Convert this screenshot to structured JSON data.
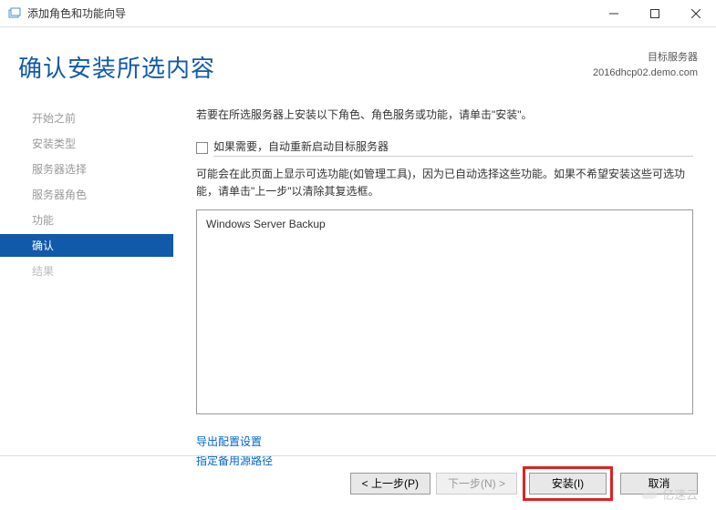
{
  "window": {
    "title": "添加角色和功能向导"
  },
  "header": {
    "page_title": "确认安装所选内容",
    "server_label": "目标服务器",
    "server_name": "2016dhcp02.demo.com"
  },
  "sidebar": {
    "items": [
      {
        "label": "开始之前",
        "state": "completed"
      },
      {
        "label": "安装类型",
        "state": "completed"
      },
      {
        "label": "服务器选择",
        "state": "completed"
      },
      {
        "label": "服务器角色",
        "state": "completed"
      },
      {
        "label": "功能",
        "state": "completed"
      },
      {
        "label": "确认",
        "state": "active"
      },
      {
        "label": "结果",
        "state": "disabled"
      }
    ]
  },
  "main": {
    "intro": "若要在所选服务器上安装以下角色、角色服务或功能，请单击\"安装\"。",
    "checkbox_label": "如果需要，自动重新启动目标服务器",
    "info_text": "可能会在此页面上显示可选功能(如管理工具)，因为已自动选择这些功能。如果不希望安装这些可选功能，请单击\"上一步\"以清除其复选框。",
    "features": [
      "Windows Server Backup"
    ],
    "links": {
      "export": "导出配置设置",
      "alternate_path": "指定备用源路径"
    }
  },
  "footer": {
    "previous": "< 上一步(P)",
    "next": "下一步(N) >",
    "install": "安装(I)",
    "cancel": "取消"
  },
  "watermark": "亿速云"
}
